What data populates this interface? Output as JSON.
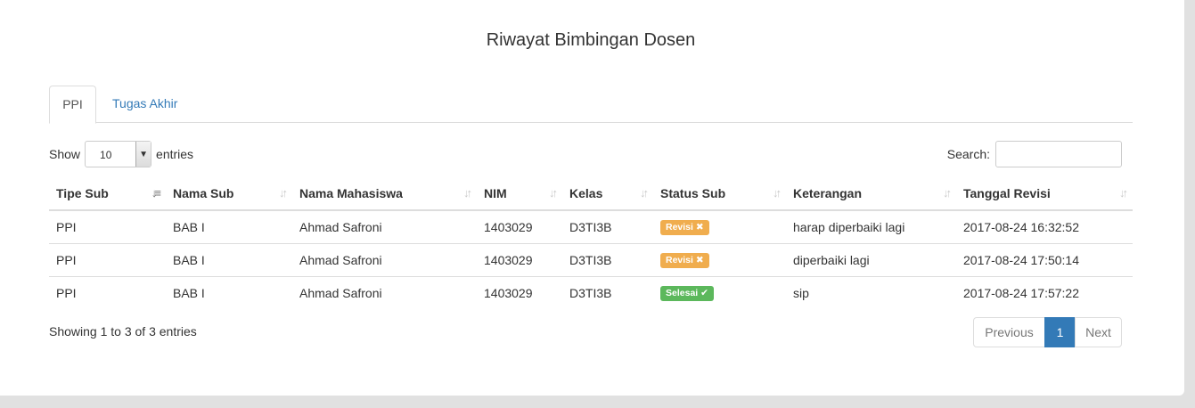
{
  "page_title": "Riwayat Bimbingan Dosen",
  "tabs": [
    {
      "label": "PPI",
      "active": true
    },
    {
      "label": "Tugas Akhir",
      "active": false
    }
  ],
  "length": {
    "prefix": "Show",
    "value": "10",
    "suffix": "entries"
  },
  "search": {
    "label": "Search:",
    "value": "",
    "placeholder": ""
  },
  "table": {
    "columns": [
      "Tipe Sub",
      "Nama Sub",
      "Nama Mahasiswa",
      "NIM",
      "Kelas",
      "Status Sub",
      "Keterangan",
      "Tanggal Revisi"
    ],
    "rows": [
      {
        "tipe": "PPI",
        "nama_sub": "BAB I",
        "mahasiswa": "Ahmad Safroni",
        "nim": "1403029",
        "kelas": "D3TI3B",
        "status": "Revisi ✖",
        "keterangan": "harap diperbaiki lagi",
        "tanggal": "2017-08-24 16:32:52"
      },
      {
        "tipe": "PPI",
        "nama_sub": "BAB I",
        "mahasiswa": "Ahmad Safroni",
        "nim": "1403029",
        "kelas": "D3TI3B",
        "status": "Revisi ✖",
        "keterangan": "diperbaiki lagi",
        "tanggal": "2017-08-24 17:50:14"
      },
      {
        "tipe": "PPI",
        "nama_sub": "BAB I",
        "mahasiswa": "Ahmad Safroni",
        "nim": "1403029",
        "kelas": "D3TI3B",
        "status": "Selesai ✔",
        "keterangan": "sip",
        "tanggal": "2017-08-24 17:57:22"
      }
    ]
  },
  "info": "Showing 1 to 3 of 3 entries",
  "pagination": {
    "previous": "Previous",
    "current": "1",
    "next": "Next"
  },
  "colors": {
    "primary": "#337ab7",
    "warning": "#f0ad4e",
    "success": "#5cb85c"
  }
}
